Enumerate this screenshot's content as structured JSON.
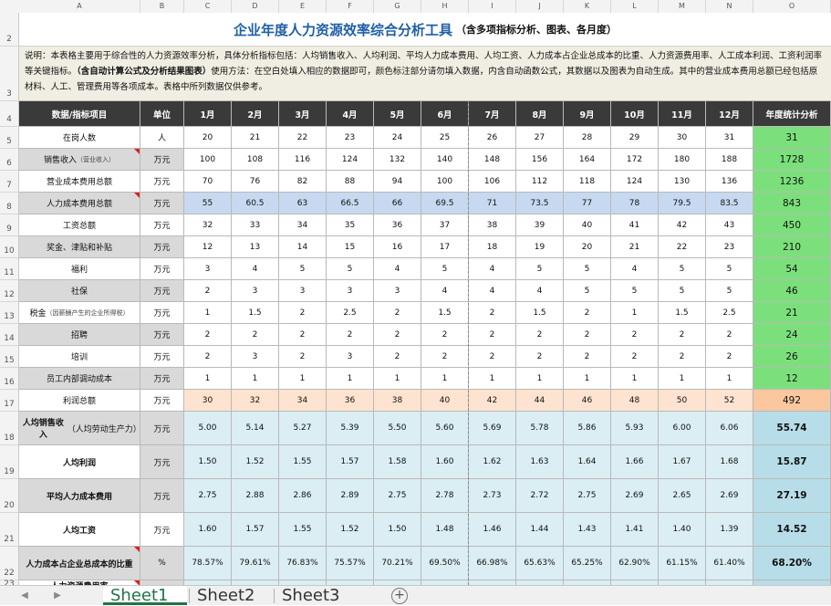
{
  "column_letters": [
    "A",
    "B",
    "C",
    "D",
    "E",
    "F",
    "G",
    "H",
    "I",
    "J",
    "K",
    "L",
    "M",
    "N",
    "O"
  ],
  "title": {
    "main": "企业年度人力资源效率综合分析工具",
    "sub": "（含多项指标分析、图表、各月度）"
  },
  "description": {
    "part1": "说明：本表格主要用于综合性的人力资源效率分析，具体分析指标包括：人均销售收入、人均利润、平均人力成本费用、人均工资、人力成本占企业总成本的比重、人力资源费用率、人工成本利润、工资利润率等关键指标。",
    "bold": "（含自动计算公式及分析结果图表）",
    "part2": "使用方法：在空白处填入相应的数据即可，颜色标注部分请勿填入数据，内含自动函数公式，其数据以及图表为自动生成。其中的营业成本费用总额已经包括原材料、人工、管理费用等各项成本。表格中所列数据仅供参考。"
  },
  "header": {
    "item": "数据/指标项目",
    "unit": "单位",
    "months": [
      "1月",
      "2月",
      "3月",
      "4月",
      "5月",
      "6月",
      "7月",
      "8月",
      "9月",
      "10月",
      "11月",
      "12月"
    ],
    "total": "年度统计分析"
  },
  "rows": [
    {
      "num": "5",
      "label": "在岗人数",
      "unit": "人",
      "values": [
        "20",
        "21",
        "22",
        "23",
        "24",
        "25",
        "26",
        "27",
        "28",
        "29",
        "30",
        "31"
      ],
      "total": "31"
    },
    {
      "num": "6",
      "label": "销售收入",
      "note": "（营业收入）",
      "unit": "万元",
      "values": [
        "100",
        "108",
        "116",
        "124",
        "132",
        "140",
        "148",
        "156",
        "164",
        "172",
        "180",
        "188"
      ],
      "total": "1728"
    },
    {
      "num": "7",
      "label": "营业成本费用总额",
      "unit": "万元",
      "values": [
        "70",
        "76",
        "82",
        "88",
        "94",
        "100",
        "106",
        "112",
        "118",
        "124",
        "130",
        "136"
      ],
      "total": "1236"
    },
    {
      "num": "8",
      "label": "人力成本费用总额",
      "unit": "万元",
      "values": [
        "55",
        "60.5",
        "63",
        "66.5",
        "66",
        "69.5",
        "71",
        "73.5",
        "77",
        "78",
        "79.5",
        "83.5"
      ],
      "total": "843"
    },
    {
      "num": "9",
      "label": "工资总额",
      "unit": "万元",
      "values": [
        "32",
        "33",
        "34",
        "35",
        "36",
        "37",
        "38",
        "39",
        "40",
        "41",
        "42",
        "43"
      ],
      "total": "450"
    },
    {
      "num": "10",
      "label": "奖金、津贴和补贴",
      "unit": "万元",
      "values": [
        "12",
        "13",
        "14",
        "15",
        "16",
        "17",
        "18",
        "19",
        "20",
        "21",
        "22",
        "23"
      ],
      "total": "210"
    },
    {
      "num": "11",
      "label": "福利",
      "unit": "万元",
      "values": [
        "3",
        "4",
        "5",
        "5",
        "4",
        "5",
        "4",
        "5",
        "5",
        "4",
        "5",
        "5"
      ],
      "total": "54"
    },
    {
      "num": "12",
      "label": "社保",
      "unit": "万元",
      "values": [
        "2",
        "3",
        "3",
        "3",
        "3",
        "4",
        "4",
        "4",
        "5",
        "5",
        "5",
        "5"
      ],
      "total": "46"
    },
    {
      "num": "13",
      "label": "税金",
      "note": "（因薪酬产生的企业所得税）",
      "unit": "万元",
      "values": [
        "1",
        "1.5",
        "2",
        "2.5",
        "2",
        "1.5",
        "2",
        "1.5",
        "2",
        "1",
        "1.5",
        "2.5"
      ],
      "total": "21"
    },
    {
      "num": "14",
      "label": "招聘",
      "unit": "万元",
      "values": [
        "2",
        "2",
        "2",
        "2",
        "2",
        "2",
        "2",
        "2",
        "2",
        "2",
        "2",
        "2"
      ],
      "total": "24"
    },
    {
      "num": "15",
      "label": "培训",
      "unit": "万元",
      "values": [
        "2",
        "3",
        "2",
        "3",
        "2",
        "2",
        "2",
        "2",
        "2",
        "2",
        "2",
        "2"
      ],
      "total": "26"
    },
    {
      "num": "16",
      "label": "员工内部调动成本",
      "unit": "万元",
      "values": [
        "1",
        "1",
        "1",
        "1",
        "1",
        "1",
        "1",
        "1",
        "1",
        "1",
        "1",
        "1"
      ],
      "total": "12"
    },
    {
      "num": "17",
      "label": "利润总额",
      "unit": "万元",
      "values": [
        "30",
        "32",
        "34",
        "36",
        "38",
        "40",
        "42",
        "44",
        "46",
        "48",
        "50",
        "52"
      ],
      "total": "492"
    },
    {
      "num": "18",
      "label": "人均销售收入",
      "note": "（人均劳动生产力）",
      "unit": "万元",
      "values": [
        "5.00",
        "5.14",
        "5.27",
        "5.39",
        "5.50",
        "5.60",
        "5.69",
        "5.78",
        "5.86",
        "5.93",
        "6.00",
        "6.06"
      ],
      "total": "55.74"
    },
    {
      "num": "19",
      "label": "人均利润",
      "unit": "万元",
      "values": [
        "1.50",
        "1.52",
        "1.55",
        "1.57",
        "1.58",
        "1.60",
        "1.62",
        "1.63",
        "1.64",
        "1.66",
        "1.67",
        "1.68"
      ],
      "total": "15.87"
    },
    {
      "num": "20",
      "label": "平均人力成本费用",
      "unit": "万元",
      "values": [
        "2.75",
        "2.88",
        "2.86",
        "2.89",
        "2.75",
        "2.78",
        "2.73",
        "2.72",
        "2.75",
        "2.69",
        "2.65",
        "2.69"
      ],
      "total": "27.19"
    },
    {
      "num": "21",
      "label": "人均工资",
      "unit": "万元",
      "values": [
        "1.60",
        "1.57",
        "1.55",
        "1.52",
        "1.50",
        "1.48",
        "1.46",
        "1.44",
        "1.43",
        "1.41",
        "1.40",
        "1.39"
      ],
      "total": "14.52"
    },
    {
      "num": "22",
      "label": "人力成本占企业总成本的比重",
      "unit": "%",
      "values": [
        "78.57%",
        "79.61%",
        "76.83%",
        "75.57%",
        "70.21%",
        "69.50%",
        "66.98%",
        "65.63%",
        "65.25%",
        "62.90%",
        "61.15%",
        "61.40%"
      ],
      "total": "68.20%"
    },
    {
      "num": "23",
      "label": "人力资源费用率",
      "unit": "",
      "values": [
        "",
        "",
        "",
        "",
        "",
        "",
        "",
        "",
        "",
        "",
        "",
        ""
      ],
      "total": ""
    }
  ],
  "row_numbers_top": [
    "2",
    "3",
    "4"
  ],
  "sheet_tabs": [
    "Sheet1",
    "Sheet2",
    "Sheet3"
  ],
  "active_tab": "Sheet1",
  "add_sheet_label": "+",
  "nav_prev": "◀",
  "nav_next": "▶",
  "colors": {
    "title_blue": "#1f5fa6",
    "header_dark": "#3a3a3a",
    "total_green": "#7be07b",
    "highlight_blue": "#c6d9f0",
    "profit_peach": "#fde3d0",
    "ratio_teal": "#daeef3",
    "tab_green": "#217346"
  }
}
